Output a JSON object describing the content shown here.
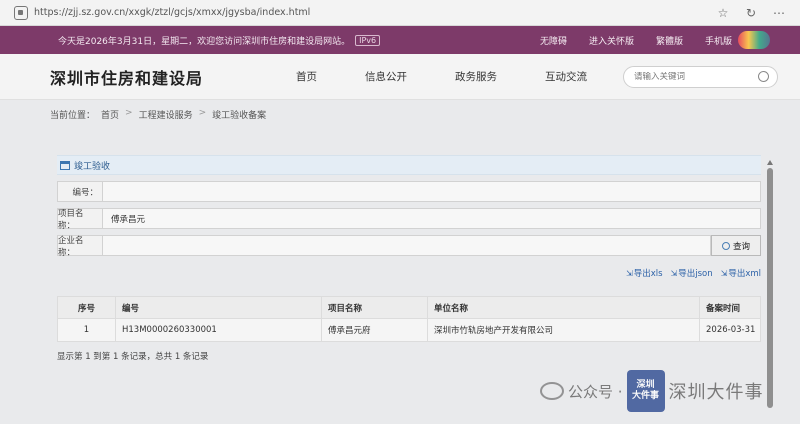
{
  "browser": {
    "url": "https://zjj.sz.gov.cn/xxgk/ztzl/gcjs/xmxx/jgysba/index.html"
  },
  "top_strip": {
    "welcome": "今天是2026年3月31日，星期二，欢迎您访问深圳市住房和建设局网站。",
    "ipv6": "IPv6",
    "links": [
      "无障碍",
      "进入关怀版",
      "繁體版",
      "手机版"
    ]
  },
  "header": {
    "title": "深圳市住房和建设局",
    "nav": [
      "首页",
      "信息公开",
      "政务服务",
      "互动交流"
    ],
    "search_placeholder": "请输入关键词"
  },
  "breadcrumb": {
    "prefix": "当前位置：",
    "items": [
      "首页",
      "工程建设服务",
      "竣工验收备案"
    ],
    "sep": ">"
  },
  "panel": {
    "title": "竣工验收",
    "fields": [
      {
        "label": "编号：",
        "value": ""
      },
      {
        "label": "项目名称：",
        "value": "傅承昌元"
      },
      {
        "label": "企业名称：",
        "value": ""
      }
    ],
    "query_label": "查询",
    "exports": [
      "导出xls",
      "导出json",
      "导出xml"
    ]
  },
  "table": {
    "headers": [
      "序号",
      "编号",
      "项目名称",
      "单位名称",
      "备案时间"
    ],
    "rows": [
      [
        "1",
        "H13M0000260330001",
        "傅承昌元府",
        "深圳市竹轨房地产开发有限公司",
        "2026-03-31"
      ]
    ]
  },
  "footer_info": "显示第 1 到第 1 条记录，总共 1 条记录",
  "watermark": {
    "prefix": "公众号 ·",
    "logo_line1": "深圳",
    "logo_line2": "大件事",
    "name": "深圳大件事"
  }
}
